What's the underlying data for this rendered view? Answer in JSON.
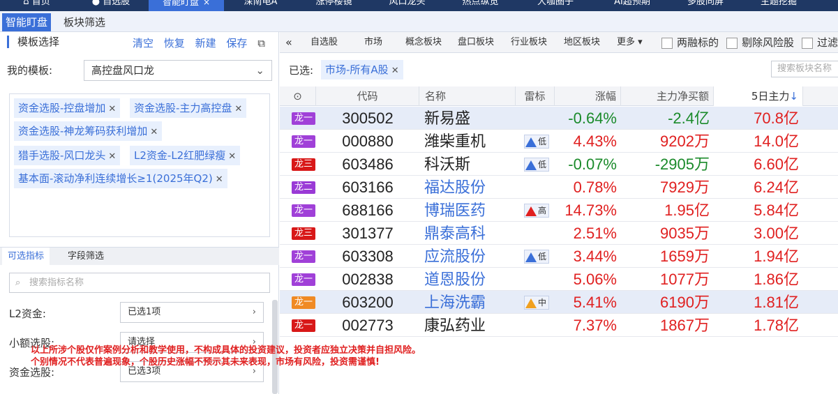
{
  "topnav": {
    "tabs": [
      {
        "label": "首页"
      },
      {
        "label": "自选股"
      },
      {
        "label": "智能盯盘",
        "active": true
      },
      {
        "label": "深南电A"
      },
      {
        "label": "涨停楼镜"
      },
      {
        "label": "风口龙头"
      },
      {
        "label": "热点纵览"
      },
      {
        "label": "大咖圈子"
      },
      {
        "label": "AI超预期"
      },
      {
        "label": "多股同屏"
      },
      {
        "label": "主题挖掘"
      }
    ],
    "close": "×"
  },
  "subtabs": [
    {
      "label": "智能盯盘",
      "active": true
    },
    {
      "label": "板块筛选"
    }
  ],
  "left": {
    "title": "模板选择",
    "actions": [
      "清空",
      "恢复",
      "新建",
      "保存"
    ],
    "template_label": "我的模板:",
    "template_value": "高控盘风口龙",
    "tags": [
      "资金选股-控盘增加",
      "资金选股-主力高控盘",
      "资金选股-神龙筹码获利增加",
      "猎手选股-风口龙头",
      "L2资金-L2红肥绿瘦",
      "基本面-滚动净利连续增长≥1(2025年Q2)"
    ],
    "filter_tabs": [
      {
        "label": "可选指标",
        "active": true
      },
      {
        "label": "字段筛选"
      }
    ],
    "search_placeholder": "搜索指标名称",
    "filters": [
      {
        "label": "L2资金:",
        "value": "已选1项"
      },
      {
        "label": "小额选股:",
        "value": "请选择"
      },
      {
        "label": "资金选股:",
        "value": "已选3项"
      }
    ]
  },
  "right": {
    "category_tabs": [
      "自选股",
      "市场",
      "概念板块",
      "盘口板块",
      "行业板块",
      "地区板块",
      "更多"
    ],
    "checkboxes": [
      "两融标的",
      "剔除风险股",
      "过滤"
    ],
    "selected_label": "已选:",
    "selected_tag": "市场-所有A股",
    "block_search_placeholder": "搜索板块名称",
    "columns": [
      "代码",
      "名称",
      "雷标",
      "涨幅",
      "主力净买额",
      "5日主力"
    ],
    "rows": [
      {
        "badge": "龙一",
        "code": "300502",
        "name": "新易盛",
        "lei": "",
        "change": "-0.64%",
        "net": "-2.4亿",
        "five": "70.8亿",
        "hl": true
      },
      {
        "badge": "龙一",
        "code": "000880",
        "name": "潍柴重机",
        "lei": "低",
        "change": "4.43%",
        "net": "9202万",
        "five": "14.0亿"
      },
      {
        "badge": "龙三",
        "code": "603486",
        "name": "科沃斯",
        "lei": "低",
        "change": "-0.07%",
        "net": "-2905万",
        "five": "6.60亿"
      },
      {
        "badge": "龙二",
        "code": "603166",
        "name": "福达股份",
        "lei": "",
        "change": "0.78%",
        "net": "7929万",
        "five": "6.24亿"
      },
      {
        "badge": "龙一",
        "code": "688166",
        "name": "博瑞医药",
        "lei": "高",
        "change": "14.73%",
        "net": "1.95亿",
        "five": "5.84亿"
      },
      {
        "badge": "龙三",
        "code": "301377",
        "name": "鼎泰高科",
        "lei": "",
        "change": "2.51%",
        "net": "9035万",
        "five": "3.00亿"
      },
      {
        "badge": "龙一",
        "code": "603308",
        "name": "应流股份",
        "lei": "低",
        "change": "3.44%",
        "net": "1659万",
        "five": "1.94亿"
      },
      {
        "badge": "龙一",
        "code": "002838",
        "name": "道恩股份",
        "lei": "",
        "change": "5.06%",
        "net": "1077万",
        "five": "1.86亿"
      },
      {
        "badge": "龙一",
        "code": "603200",
        "name": "上海洗霸",
        "lei": "中",
        "change": "5.41%",
        "net": "6190万",
        "five": "1.81亿",
        "hl": true
      },
      {
        "badge": "龙一",
        "code": "002773",
        "name": "康弘药业",
        "lei": "",
        "change": "7.37%",
        "net": "1867万",
        "five": "1.78亿"
      }
    ]
  },
  "disclaimer": {
    "line1": "以上所涉个股仅作案例分析和教学使用，不构成具体的投资建议，投资者应独立决策并自担风险。",
    "line2": "个别情况不代表普遍现象，个股历史涨幅不预示其未来表现，市场有风险，投资需谨慎!"
  },
  "colors": {
    "accent": "#3a6fd8",
    "badge_long1": "#a040d8",
    "badge_long2": "#9a3ad6",
    "badge_long3": "#d81818",
    "badge_orange": "#f08a24",
    "up": "#e02020",
    "down": "#1a8a2a",
    "lei_low": "#3a6fd8",
    "lei_high": "#e02020",
    "lei_mid": "#f0a020"
  }
}
